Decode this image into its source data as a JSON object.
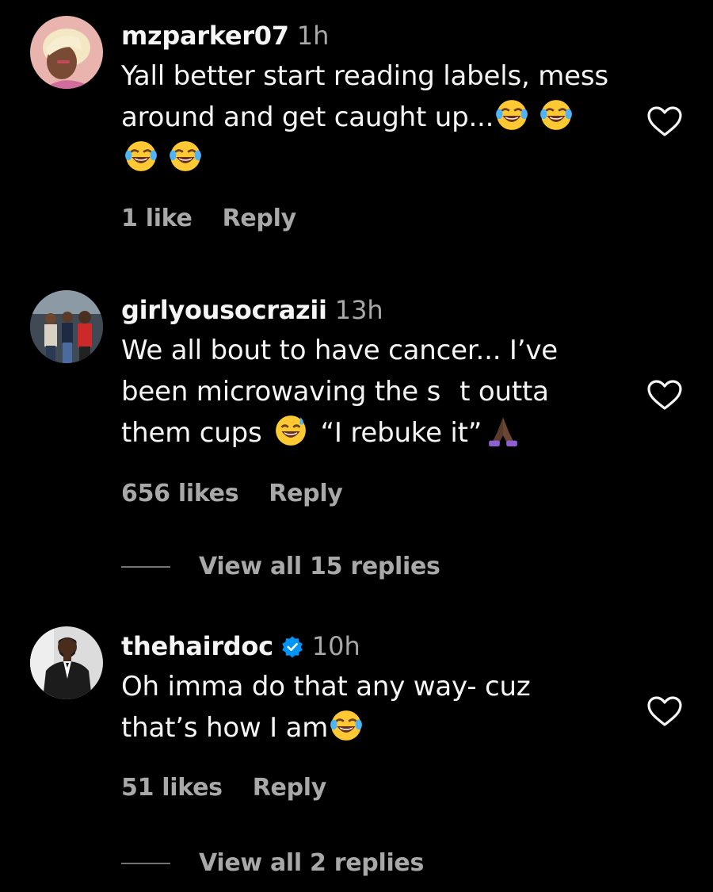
{
  "comments": [
    {
      "username": "mzparker07",
      "time": "1h",
      "verified": false,
      "lines": [
        {
          "parts": [
            "Yall better start reading labels, mess"
          ]
        },
        {
          "parts": [
            "around and get caught up..."
          ]
        }
      ],
      "likes": "1 like",
      "reply_label": "Reply"
    },
    {
      "username": "girlyousocrazii",
      "time": "13h",
      "verified": false,
      "lines": [
        {
          "parts": [
            "We all bout to have cancer... I’ve"
          ]
        },
        {
          "parts": [
            "been microwaving the s",
            "t outta"
          ]
        },
        {
          "parts": [
            "them cups",
            "“I rebuke it”"
          ]
        }
      ],
      "likes": "656 likes",
      "reply_label": "Reply",
      "view_replies": "View all 15 replies"
    },
    {
      "username": "thehairdoc",
      "time": "10h",
      "verified": true,
      "lines": [
        {
          "parts": [
            "Oh imma do that any way- cuz"
          ]
        },
        {
          "parts": [
            "that’s how I am"
          ]
        }
      ],
      "likes": "51 likes",
      "reply_label": "Reply",
      "view_replies": "View all 2 replies"
    }
  ],
  "icons": {
    "heart": "heart-outline-icon",
    "laugh": "face-with-tears-of-joy-emoji",
    "sweat_smile": "grinning-face-with-sweat-emoji",
    "pray": "folded-hands-emoji",
    "verified": "verified-badge-icon"
  },
  "colors": {
    "background": "#000000",
    "primary_text": "#f5f5f5",
    "secondary_text": "#a8a8a8",
    "verified_blue": "#0095f6"
  }
}
